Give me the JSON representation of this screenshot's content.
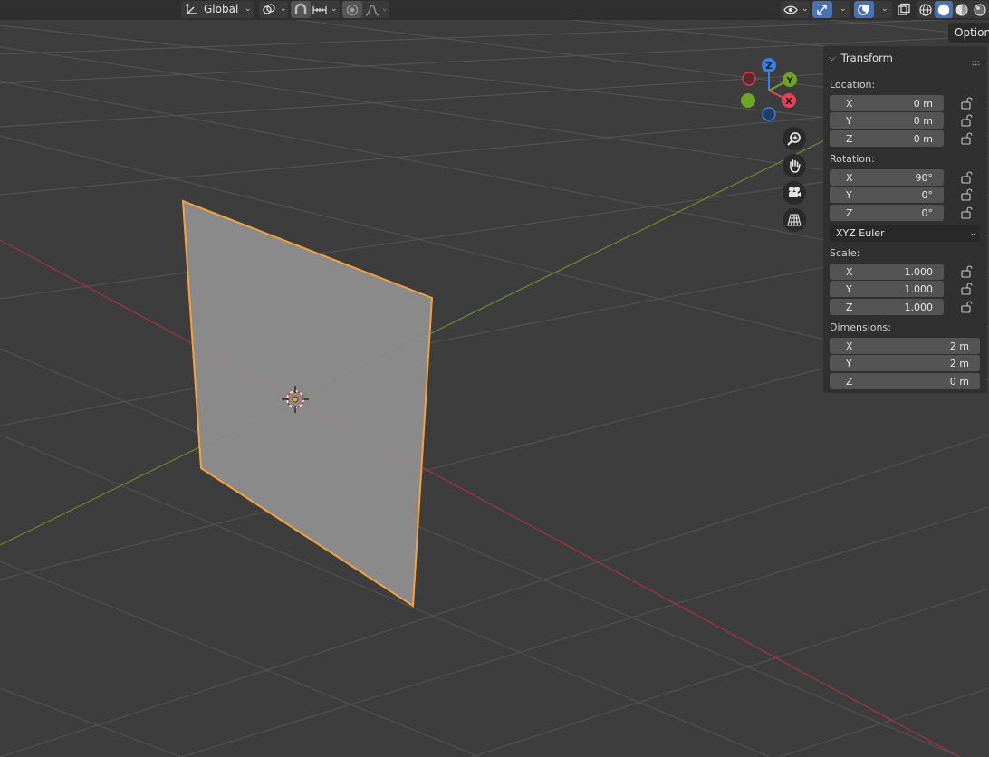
{
  "header": {
    "orientation_label": "Global",
    "options_label": "Options"
  },
  "icons": [
    "transform-orientation-icon",
    "pivot-icon",
    "snap-icon",
    "snap-increment-icon",
    "proportional-editing-icon",
    "falloff-icon",
    "visibility-icon",
    "gizmo-icon",
    "overlay-icon",
    "xray-icon",
    "wireframe-shading-icon",
    "solid-shading-icon",
    "material-shading-icon",
    "rendered-shading-icon",
    "zoom-icon",
    "hand-pan-icon",
    "camera-icon",
    "perspective-grid-icon",
    "lock-icon"
  ],
  "gizmo": {
    "x": "X",
    "y": "Y",
    "z": "Z"
  },
  "panel": {
    "title": "Transform",
    "location": {
      "label": "Location:",
      "rows": [
        {
          "axis": "X",
          "value": "0 m"
        },
        {
          "axis": "Y",
          "value": "0 m"
        },
        {
          "axis": "Z",
          "value": "0 m"
        }
      ]
    },
    "rotation": {
      "label": "Rotation:",
      "rows": [
        {
          "axis": "X",
          "value": "90°"
        },
        {
          "axis": "Y",
          "value": "0°"
        },
        {
          "axis": "Z",
          "value": "0°"
        }
      ],
      "mode": "XYZ Euler"
    },
    "scale": {
      "label": "Scale:",
      "rows": [
        {
          "axis": "X",
          "value": "1.000"
        },
        {
          "axis": "Y",
          "value": "1.000"
        },
        {
          "axis": "Z",
          "value": "1.000"
        }
      ]
    },
    "dimensions": {
      "label": "Dimensions:",
      "rows": [
        {
          "axis": "X",
          "value": "2 m"
        },
        {
          "axis": "Y",
          "value": "2 m"
        },
        {
          "axis": "Z",
          "value": "0 m"
        }
      ]
    }
  },
  "colors": {
    "background": "#3d3d3d",
    "grid": "#545454",
    "x_axis": "#a8343f",
    "y_axis": "#6d8a2c",
    "selection_outline": "#f5a142",
    "plane_face": "#8c8c8c",
    "active_shading": "#ffffff"
  }
}
